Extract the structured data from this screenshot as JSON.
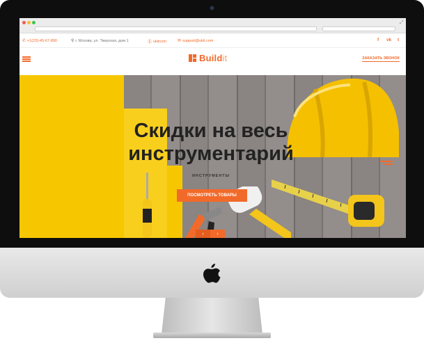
{
  "contact": {
    "phone": "+1(23)-45-67-890",
    "address": "г. Москва, ул. Тверская, дом 1",
    "skype": "ukitcom",
    "email": "support@ukit.com"
  },
  "social": [
    "f",
    "vk",
    "t"
  ],
  "header": {
    "logo_main": "Build",
    "logo_suffix": "it",
    "callback": "ЗАКАЗАТЬ ЗВОНОК"
  },
  "hero": {
    "title": "Скидки на весь инструментарий",
    "subtitle": "ИНСТРУМЕНТЫ",
    "button": "ПОСМОТРЕТЬ ТОВАРЫ"
  },
  "colors": {
    "accent": "#f26a2a",
    "yellow": "#f6c700",
    "bezel": "#0e0e0e"
  },
  "icons": [
    "phone-icon",
    "location-pin-icon",
    "skype-icon",
    "email-icon",
    "menu-icon",
    "logo-icon",
    "apple-logo-icon",
    "arrow-left-icon",
    "arrow-right-icon"
  ]
}
